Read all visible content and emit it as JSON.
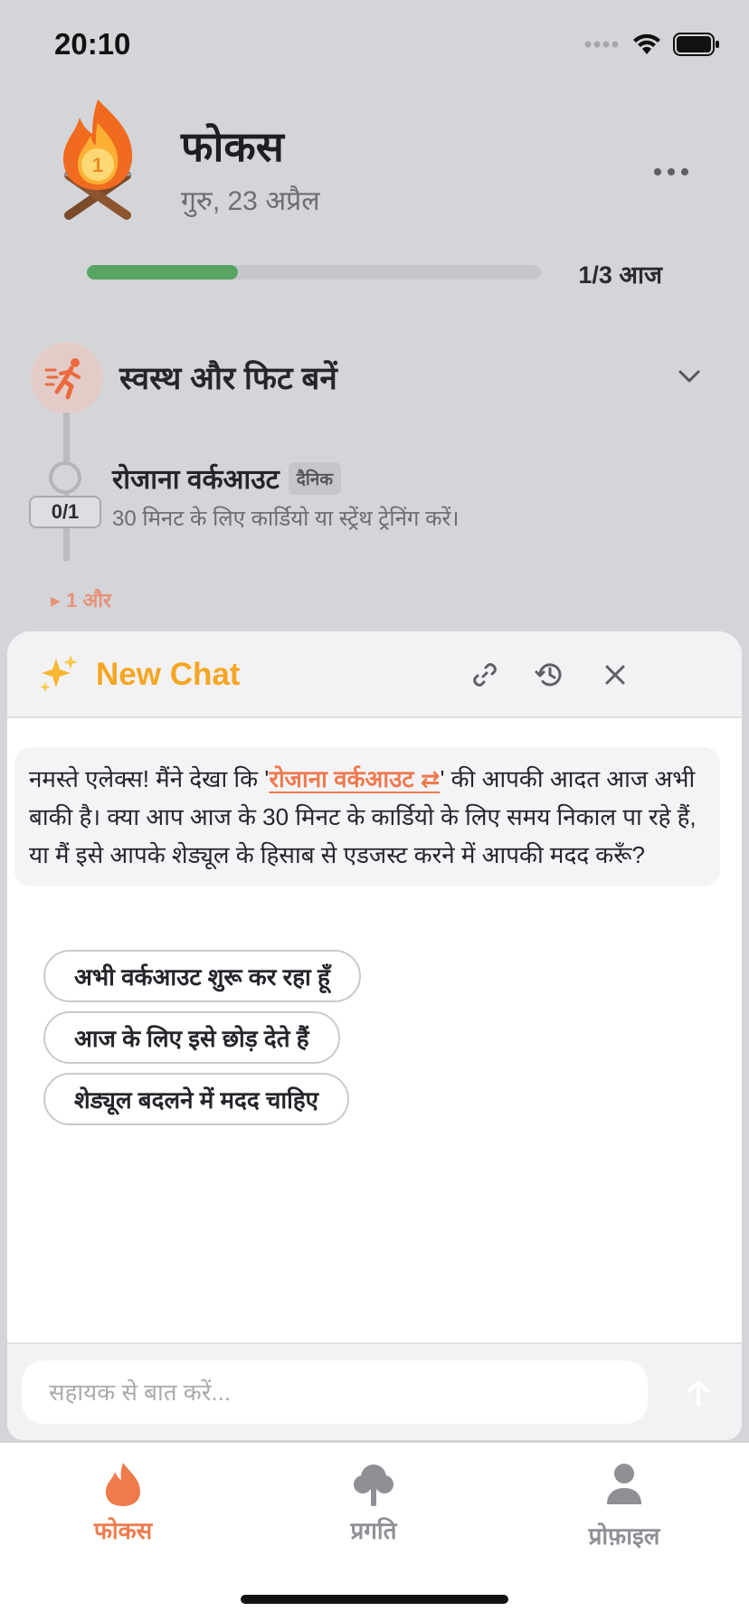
{
  "status_bar": {
    "time": "20:10"
  },
  "header": {
    "title": "फोकस",
    "date": "गुरु, 23 अप्रैल"
  },
  "progress": {
    "label": "1/3 आज",
    "completed": 1,
    "total": 3
  },
  "goal": {
    "title": "स्वस्थ और फिट बनें",
    "habit": {
      "title": "रोजाना वर्कआउट",
      "frequency_tag": "दैनिक",
      "description": "30 मिनट के लिए कार्डियो या स्ट्रेंथ ट्रेनिंग करें।",
      "count": "0/1"
    },
    "more_link": "▸ 1 और"
  },
  "chat": {
    "title": "New Chat",
    "message": {
      "part1": "नमस्ते एलेक्स! मैंने देखा कि '",
      "habit_link": "रोजाना वर्कआउट ⇄",
      "part2": "' की आपकी आदत आज अभी बाकी है। क्या आप आज के 30 मिनट के कार्डियो के लिए समय निकाल पा रहे हैं, या मैं इसे आपके शेड्यूल के हिसाब से एडजस्ट करने में आपकी मदद करूँ?"
    },
    "suggestions": [
      "अभी वर्कआउट शुरू कर रहा हूँ",
      "आज के लिए इसे छोड़ देते हैं",
      "शेड्यूल बदलने में मदद चाहिए"
    ],
    "input_placeholder": "सहायक से बात करें..."
  },
  "tabs": [
    {
      "label": "फोकस",
      "icon": "flame-icon",
      "active": true
    },
    {
      "label": "प्रगति",
      "icon": "tree-icon",
      "active": false
    },
    {
      "label": "प्रोफ़ाइल",
      "icon": "person-icon",
      "active": false
    }
  ],
  "colors": {
    "accent": "#ee7a4f",
    "chat_title": "#f6a623",
    "progress": "#58a464",
    "inactive_tab": "#8e9096"
  }
}
